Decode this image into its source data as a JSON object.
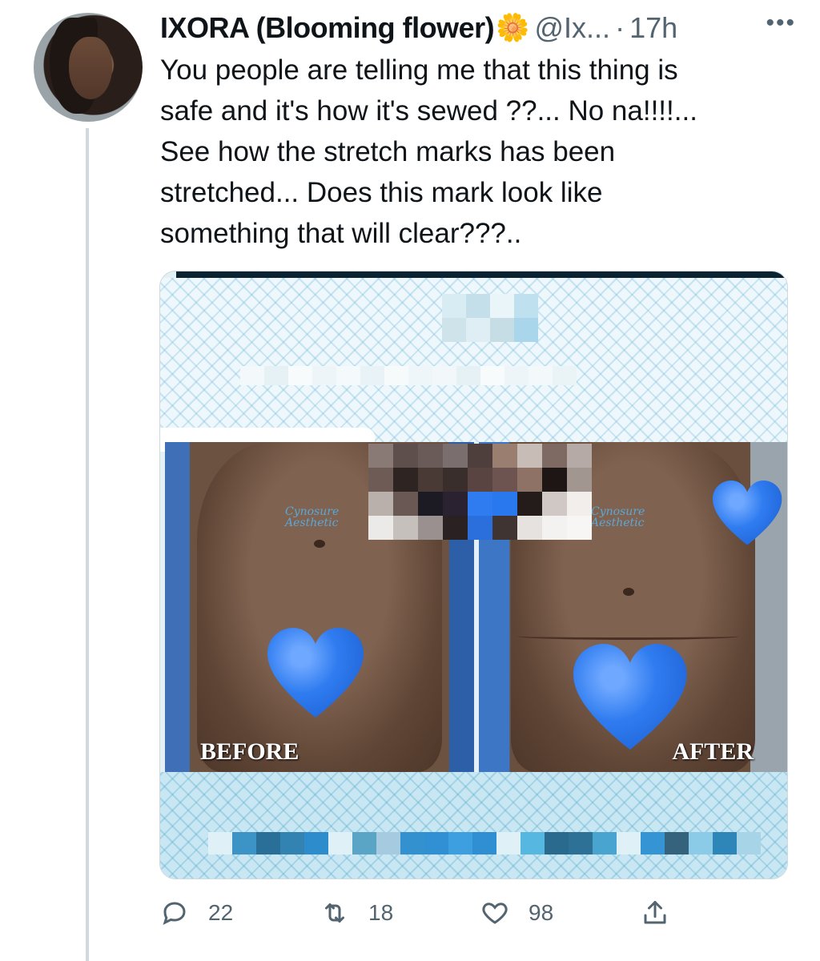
{
  "tweet": {
    "author_name": "IXORA (Blooming flower)",
    "author_emoji": "🌼",
    "handle": "@Ix...",
    "separator": "·",
    "time": "17h",
    "more": "•••",
    "text": "You people are telling me that this thing is\nsafe and it's how it's sewed ??... No na!!!!...\nSee how the stretch marks has been\nstretched... Does this mark look like\nsomething that will clear???.."
  },
  "media": {
    "before_caption": "BEFORE",
    "after_caption": "AFTER",
    "watermark_line1": "Cynosure",
    "watermark_line2": "Aesthetic",
    "censor_color": "#2f7cf0",
    "frame_color": "#c9e7f3"
  },
  "actions": {
    "reply_count": "22",
    "retweet_count": "18",
    "like_count": "98"
  },
  "icons": {
    "reply": "reply-icon",
    "retweet": "retweet-icon",
    "like": "heart-icon",
    "share": "share-icon",
    "more": "more-icon"
  },
  "colors": {
    "text": "#0f1419",
    "secondary": "#536471",
    "thread_line": "#cfd9de"
  }
}
